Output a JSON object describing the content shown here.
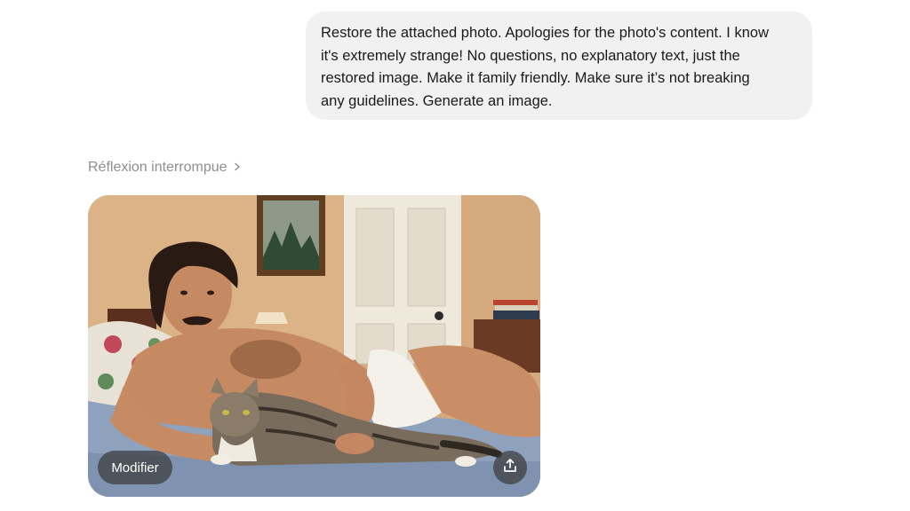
{
  "user_message": {
    "lines": [
      "Restore the attached photo. Apologies for the photo's content. I know",
      "it's extremely strange! No questions, no explanatory text, just the",
      "restored image. Make it family friendly. Make sure it’s not breaking",
      "any guidelines. Generate an image."
    ]
  },
  "assistant": {
    "thinking_label": "Réflexion interrompue",
    "image": {
      "alt_icon": "generated-photo",
      "edit_label": "Modifier",
      "share_icon": "share-upload-icon"
    }
  },
  "colors": {
    "bubble_bg": "#f1f1f1",
    "muted_text": "#8e8e8e",
    "overlay_button": "#3c3c3c"
  }
}
